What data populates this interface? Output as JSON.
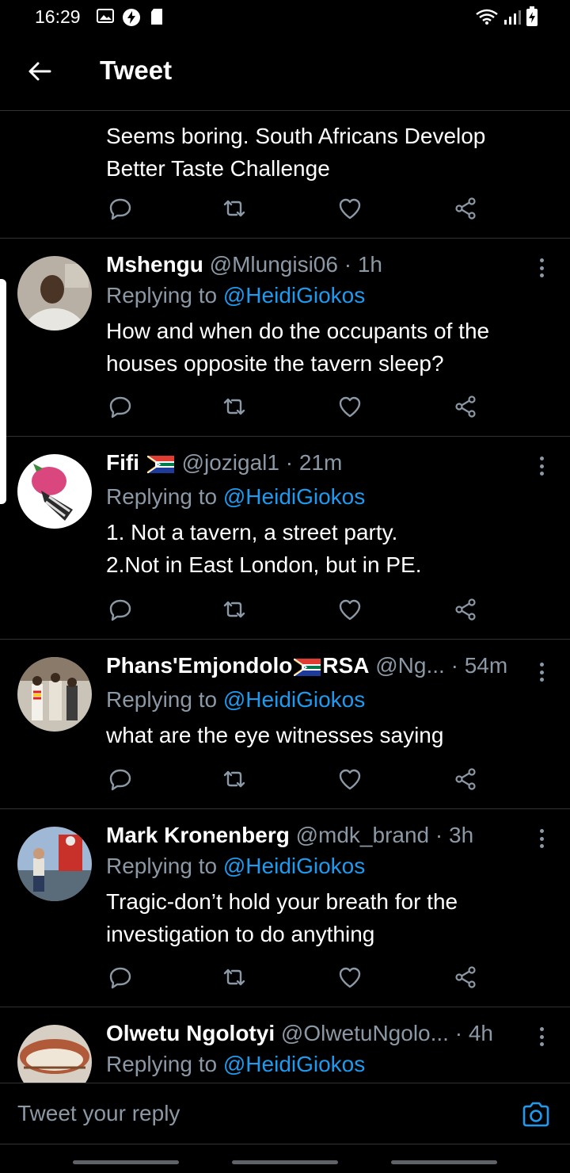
{
  "status_bar": {
    "time": "16:29",
    "icons": [
      "image-icon",
      "lightning-icon",
      "sd-card-icon",
      "wifi-icon",
      "signal-icon",
      "battery-icon"
    ]
  },
  "header": {
    "back_icon": "arrow-left-icon",
    "title": "Tweet"
  },
  "tweets": [
    {
      "text": "Seems boring. South Africans Develop\nBetter Taste Challenge"
    },
    {
      "name": "Mshengu",
      "handle": "@Mlungisi06",
      "dot": "·",
      "time": "1h",
      "replying_prefix": "Replying to",
      "replying_to": "@HeidiGiokos",
      "text": "How and when do the occupants of the\nhouses opposite the tavern sleep?"
    },
    {
      "name": "Fifi",
      "handle": "@jozigal1",
      "dot": "·",
      "time": "21m",
      "replying_prefix": "Replying to",
      "replying_to": "@HeidiGiokos",
      "text": "1. Not a tavern, a street party.\n2.Not in East London, but in PE."
    },
    {
      "name_part1": "Phans'Emjondolo",
      "name_part2": "RSA",
      "handle": "@Ng...",
      "dot": "·",
      "time": "54m",
      "replying_prefix": "Replying to",
      "replying_to": "@HeidiGiokos",
      "text": "what are the eye witnesses saying"
    },
    {
      "name": "Mark Kronenberg",
      "handle": "@mdk_brand",
      "dot": "·",
      "time": "3h",
      "replying_prefix": "Replying to",
      "replying_to": "@HeidiGiokos",
      "text": "Tragic-don’t hold your breath for the\ninvestigation to do anything"
    },
    {
      "name": "Olwetu Ngolotyi",
      "handle": "@OlwetuNgolo...",
      "dot": "·",
      "time": "4h",
      "replying_prefix": "Replying to",
      "replying_to": "@HeidiGiokos"
    }
  ],
  "action_icons": [
    "reply-icon",
    "retweet-icon",
    "like-icon",
    "share-icon"
  ],
  "reply_bar": {
    "placeholder": "Tweet your reply",
    "camera_icon": "camera-icon"
  },
  "colors": {
    "background": "#000000",
    "accent": "#1d9bf0",
    "secondary_text": "#8b98a5",
    "divider": "#2f3336"
  }
}
